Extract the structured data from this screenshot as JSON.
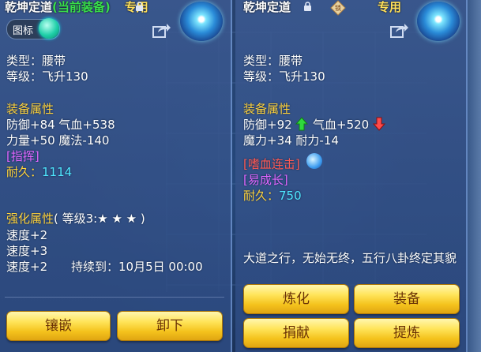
{
  "left_panel": {
    "item_name": "乾坤定道",
    "equipped_tag": "(当前装备)",
    "exclusive_tag": "专用",
    "toggle_label": "图标",
    "type_line": "类型：腰带",
    "level_line": "等级：飞升130",
    "section_attrs": "装备属性",
    "attr_line1": "防御+84 气血+538",
    "attr_line2": "力量+50 魔法-140",
    "tag_line": "[指挥]",
    "durability_label": "耐久：",
    "durability_value": "1114",
    "enhance_title": "强化属性",
    "enhance_level": "( 等级3:★ ★ ★ )",
    "enhance_1": "速度+2",
    "enhance_2": "速度+3",
    "enhance_3": "速度+2",
    "duration": "持续到：10月5日 00:00",
    "buttons": [
      "镶嵌",
      "卸下"
    ]
  },
  "right_panel": {
    "item_name": "乾坤定道",
    "exclusive_tag": "专用",
    "type_line": "类型：腰带",
    "level_line": "等级：飞升130",
    "section_attrs": "装备属性",
    "attr_def": "防御+92",
    "attr_hp": "气血+520",
    "attr_line2": "魔力+34 耐力-14",
    "skill_tag": "[嗜血连击]",
    "growth_tag": "[易成长]",
    "durability_label": "耐久：",
    "durability_value": "750",
    "description": "大道之行，无始无终，五行八卦终定其貌",
    "buttons": [
      "炼化",
      "装备",
      "捐献",
      "提炼"
    ]
  },
  "colors": {
    "gold_text": "#ffd33d",
    "green_text": "#39e04b",
    "purple_text": "#e066ff",
    "cyan_text": "#4fe6ff",
    "red_text": "#ff5a55",
    "button_gold": "#f4c21c"
  },
  "icons": [
    "lock-icon",
    "share-icon",
    "emblem-icon",
    "up-arrow-icon",
    "down-arrow-icon",
    "swirl-icon"
  ]
}
